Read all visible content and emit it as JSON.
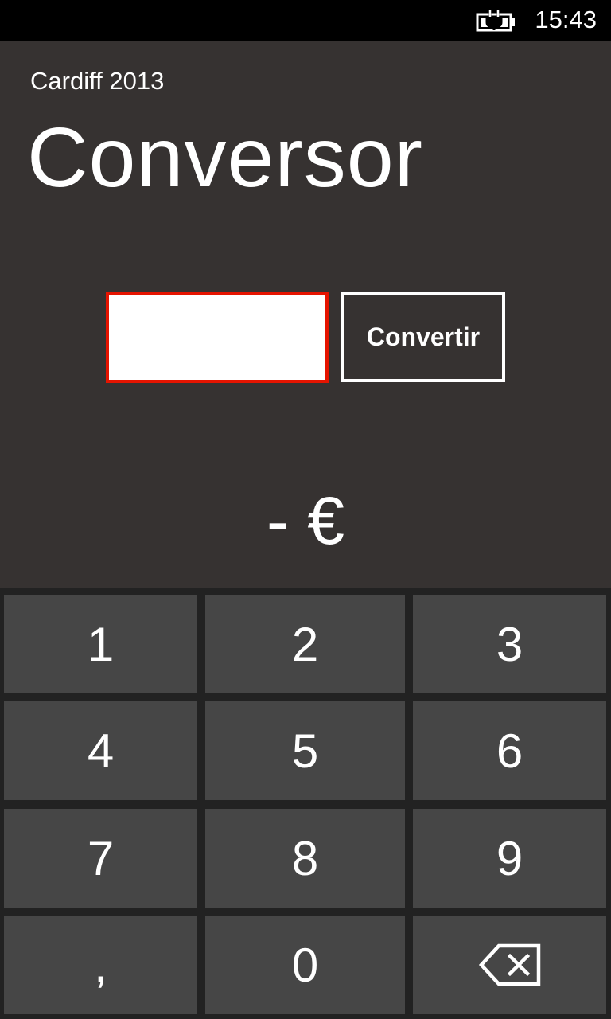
{
  "status_bar": {
    "time": "15:43",
    "battery_icon": "battery-charging-icon"
  },
  "app": {
    "subtitle": "Cardiff 2013",
    "title": "Conversor",
    "input": {
      "value": "",
      "placeholder": ""
    },
    "convert_label": "Convertir",
    "result": "- €",
    "accent_color": "#e51400"
  },
  "keypad": {
    "keys": [
      "1",
      "2",
      "3",
      "4",
      "5",
      "6",
      "7",
      "8",
      "9",
      ",",
      "0"
    ],
    "backspace_icon": "backspace-icon"
  }
}
